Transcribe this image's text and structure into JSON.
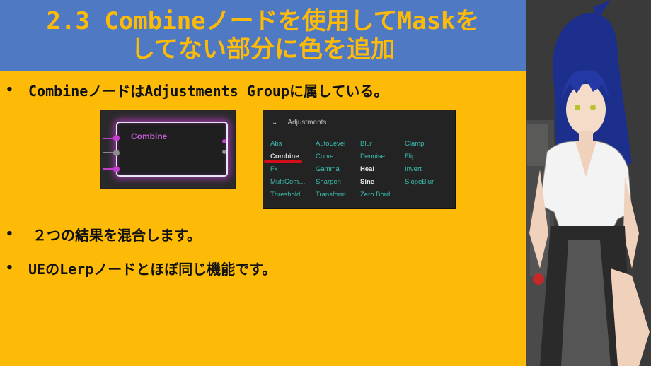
{
  "title": {
    "line1": "2.3 Combineノードを使用してMaskを",
    "line2": "してない部分に色を追加"
  },
  "bullets": [
    {
      "mark": "•",
      "text": "CombineノードはAdjustments Groupに属している。"
    },
    {
      "mark": "•",
      "text": "２つの結果を混合します。"
    },
    {
      "mark": "•",
      "text": "UEのLerpノードとほぼ同じ機能です。"
    }
  ],
  "node": {
    "title": "Combine",
    "accent": "#c63fce"
  },
  "adjustments": {
    "header": "Adjustments",
    "chevron": "chevron-down-icon",
    "items": [
      [
        "Abs",
        "AutoLevel",
        "Blur",
        "Clamp"
      ],
      [
        "Combine",
        "Curve",
        "Denoise",
        "Flip"
      ],
      [
        "Fx",
        "Gamma",
        "Heal",
        "Invert"
      ],
      [
        "MultiCom…",
        "Sharpen",
        "Sine",
        "SlopeBlur"
      ],
      [
        "Threshold",
        "Transform",
        "Zero Bord…",
        ""
      ]
    ],
    "selected": "Combine",
    "item_color": "#3bbfb0"
  },
  "colors": {
    "slide_bg": "#fdbb08",
    "title_bar": "#4f79c3",
    "title_text": "#fdbb08",
    "underline": "#d20f18"
  }
}
